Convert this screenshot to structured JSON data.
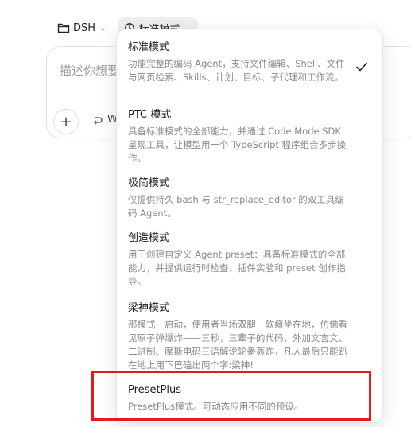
{
  "topbar": {
    "project_label": "DSH",
    "mode_label": "标准模式"
  },
  "composer": {
    "placeholder": "描述你想要",
    "tool_label": "W"
  },
  "modes": [
    {
      "title": "标准模式",
      "desc": "功能完整的编码 Agent，支持文件编辑、Shell、文件与网页检索、Skills、计划、目标、子代理和工作流。",
      "selected": true
    },
    {
      "title": "PTC 模式",
      "desc": "具备标准模式的全部能力，并通过 Code Mode SDK 呈现工具，让模型用一个 TypeScript 程序组合多步操作。",
      "selected": false
    },
    {
      "title": "极简模式",
      "desc": "仅提供持久 bash 与 str_replace_editor 的双工具编码 Agent。",
      "selected": false
    },
    {
      "title": "创造模式",
      "desc": "用于创建自定义 Agent preset：具备标准模式的全部能力，并提供运行时检查、插件实验和 preset 创作指导。",
      "selected": false
    },
    {
      "title": "梁神模式",
      "desc": "那模式一启动，使用者当场双腿一软瘫坐在地，仿佛看见原子弹爆炸——三秒，三辈子的代码，外加文言文、二进制、摩斯电码三语解说轮番轰炸，凡人最后只能趴在地上用下巴磕出两个字:梁神!",
      "selected": false
    },
    {
      "title": "PresetPlus",
      "desc": "PresetPlus模式。可动态应用不同的预设。",
      "selected": false
    }
  ],
  "colors": {
    "highlight": "#e21c1c",
    "muted_text": "#8a8a8a"
  }
}
